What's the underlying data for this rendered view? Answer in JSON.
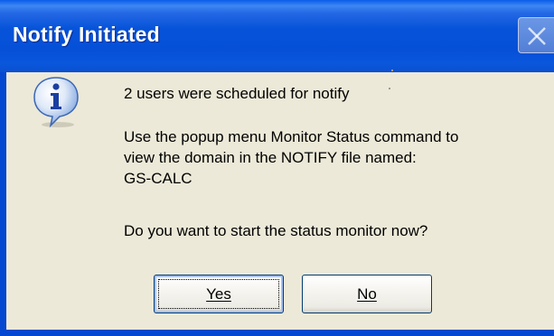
{
  "dialog": {
    "title": "Notify Initiated",
    "icon": "info-icon",
    "message_line1": "2 users were scheduled for notify",
    "message_line2": "Use the popup menu Monitor Status command to",
    "message_line3": "view the domain in the NOTIFY file named:",
    "message_line4": "GS-CALC",
    "question": "Do you want to start the status monitor now?",
    "buttons": {
      "yes": "Yes",
      "no": "No"
    }
  },
  "colors": {
    "titlebar": "#0054e3",
    "client": "#ece9d8",
    "title_text": "#ffffff"
  }
}
